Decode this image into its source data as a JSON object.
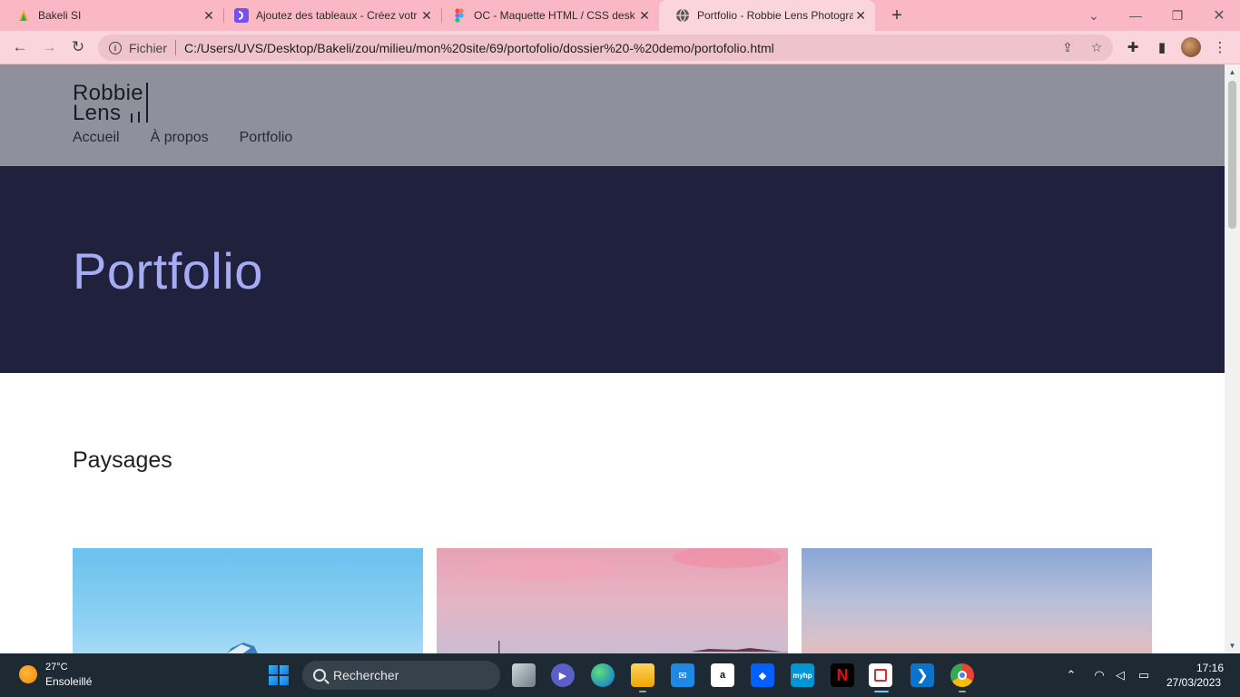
{
  "browser": {
    "tabs": [
      {
        "title": "Bakeli SI",
        "icon": "bakeli-icon",
        "active": false
      },
      {
        "title": "Ajoutez des tableaux - Créez votr",
        "icon": "openclassrooms-icon",
        "active": false
      },
      {
        "title": "OC - Maquette HTML / CSS desk",
        "icon": "figma-icon",
        "active": false
      },
      {
        "title": "Portfolio - Robbie Lens Photogra",
        "icon": "globe-icon",
        "active": true
      }
    ],
    "address": {
      "scheme_label": "Fichier",
      "url": "C:/Users/UVS/Desktop/Bakeli/zou/milieu/mon%20site/69/portofolio/dossier%20-%20demo/portofolio.html"
    }
  },
  "site": {
    "logo_line1": "Robbie",
    "logo_line2": "Lens",
    "nav": [
      "Accueil",
      "À propos",
      "Portfolio"
    ],
    "hero_title": "Portfolio",
    "section_title": "Paysages",
    "header_color": "#8f909c",
    "hero_color": "#20213d",
    "hero_text_color": "#a5acf5"
  },
  "taskbar": {
    "weather_temp": "27°C",
    "weather_desc": "Ensoleillé",
    "search_label": "Rechercher",
    "time": "17:16",
    "date": "27/03/2023",
    "apps": [
      "task-view-icon",
      "teams-icon",
      "edge-icon",
      "file-explorer-icon",
      "mail-icon",
      "amazon-icon",
      "dropbox-icon",
      "myhp-icon",
      "netflix-icon",
      "snipping-tool-icon",
      "vscode-icon",
      "chrome-icon"
    ]
  }
}
